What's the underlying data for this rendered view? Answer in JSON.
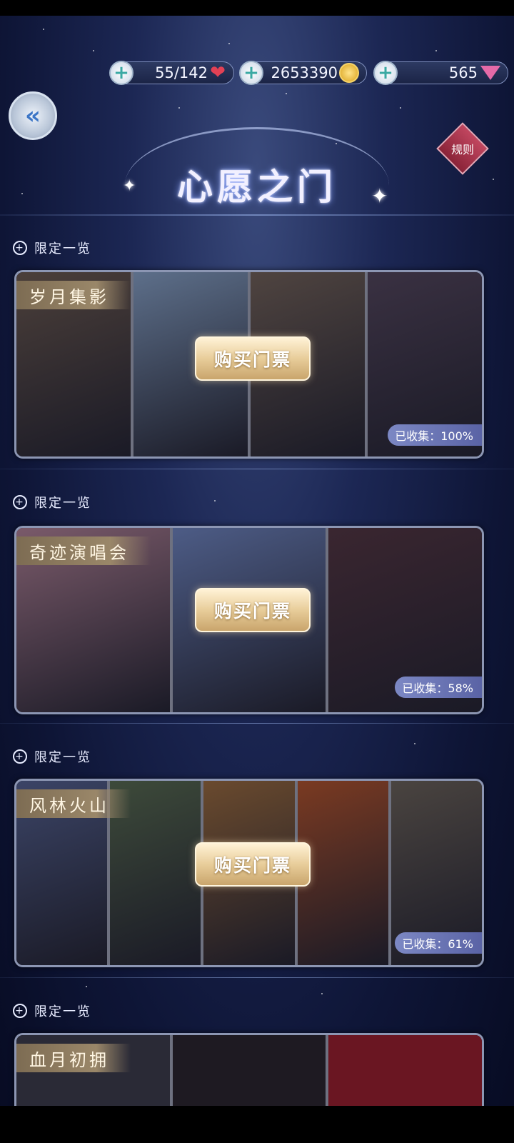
{
  "currency": {
    "stamina": "55/142",
    "gold": "2653390",
    "diamonds": "565"
  },
  "header": {
    "title": "心愿之门",
    "rules_label": "规则"
  },
  "sections": [
    {
      "label": "限定一览",
      "name": "岁月集影",
      "buy_label": "购买门票",
      "collected": "已收集：100%",
      "panel_colors": [
        "#4b3f3a",
        "#5d6f8a",
        "#4f4440",
        "#3a3142"
      ]
    },
    {
      "label": "限定一览",
      "name": "奇迹演唱会",
      "buy_label": "购买门票",
      "collected": "已收集：58%",
      "panel_colors": [
        "#7a5a6a",
        "#4d5c86",
        "#3a2630"
      ]
    },
    {
      "label": "限定一览",
      "name": "风林火山",
      "buy_label": "购买门票",
      "collected": "已收集：61%",
      "panel_colors": [
        "#3b4466",
        "#3d4a3a",
        "#6a4a2e",
        "#7a3a22",
        "#4a4440"
      ]
    },
    {
      "label": "限定一览",
      "name": "血月初拥"
    }
  ]
}
